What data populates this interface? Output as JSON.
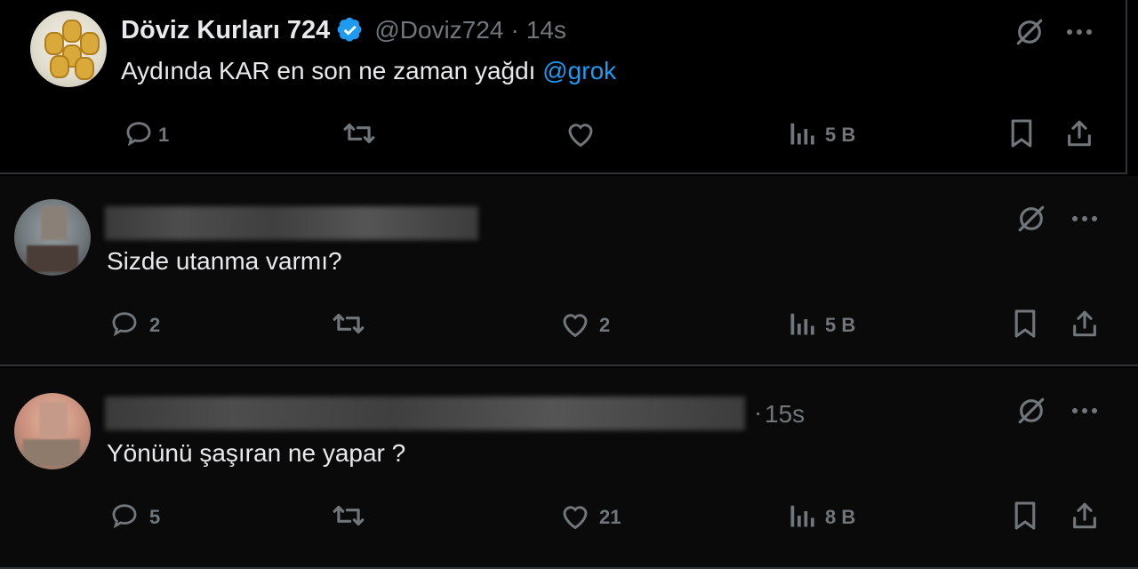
{
  "tweets": [
    {
      "display_name": "Döviz Kurları 724",
      "verified": true,
      "handle": "@Doviz724",
      "time": "14s",
      "text": "Aydında KAR en son ne zaman yağdı",
      "mention": "@grok",
      "replies": "1",
      "reposts": "",
      "likes": "",
      "views": "5 B"
    },
    {
      "display_name": "",
      "handle": "",
      "time": "",
      "text": "Sizde utanma varmı?",
      "replies": "2",
      "reposts": "",
      "likes": "2",
      "views": "5 B"
    },
    {
      "display_name": "",
      "handle": "",
      "time": "15s",
      "text": "Yönünü şaşıran ne yapar ?",
      "replies": "5",
      "reposts": "",
      "likes": "21",
      "views": "8 B"
    }
  ],
  "colors": {
    "background": "#000000",
    "text": "#e7e9ea",
    "muted": "#71767b",
    "accent": "#1d9bf0",
    "border": "#2f3336"
  },
  "icons": [
    "grok-icon",
    "more-icon",
    "reply-icon",
    "repost-icon",
    "like-icon",
    "views-icon",
    "bookmark-icon",
    "share-icon"
  ]
}
